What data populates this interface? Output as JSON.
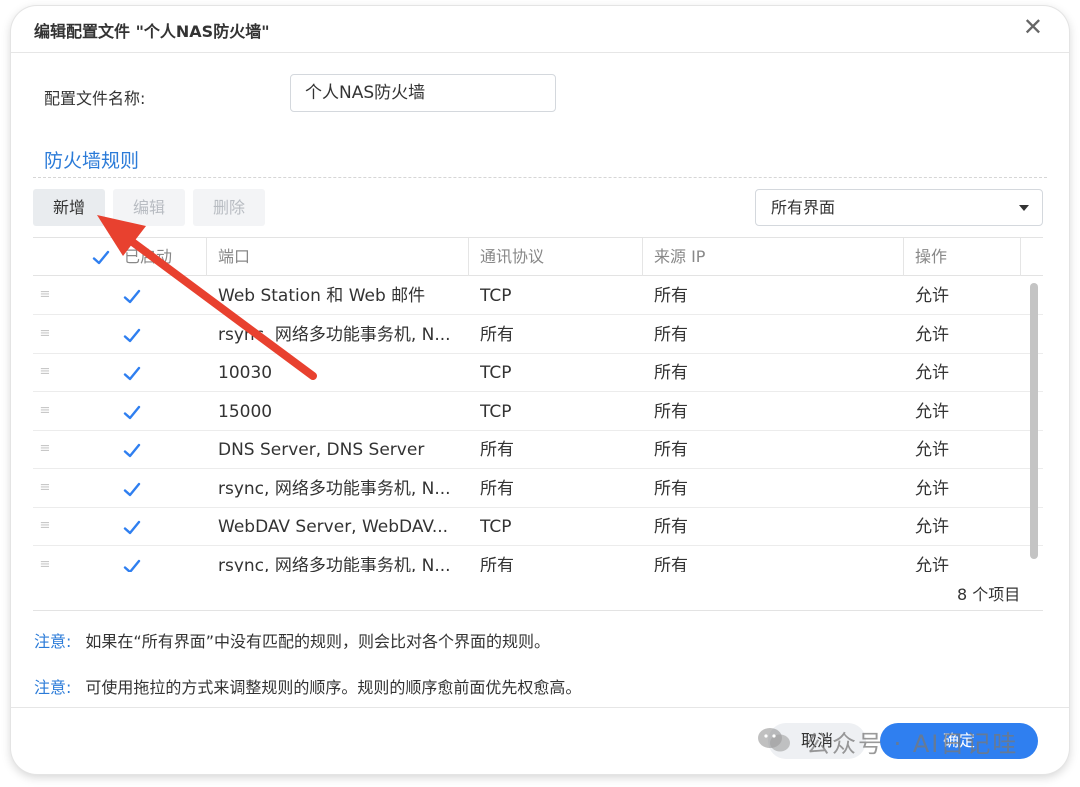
{
  "window": {
    "title": "编辑配置文件 \"个人NAS防火墙\""
  },
  "profile": {
    "label": "配置文件名称:",
    "value": "个人NAS防火墙"
  },
  "section": {
    "title": "防火墙规则"
  },
  "toolbar": {
    "add_label": "新增",
    "edit_label": "编辑",
    "delete_label": "删除"
  },
  "interface_select": {
    "value": "所有界面"
  },
  "table": {
    "headers": {
      "enabled": "已启动",
      "port": "端口",
      "protocol": "通讯协议",
      "source_ip": "来源 IP",
      "action": "操作"
    },
    "rows": [
      {
        "enabled": true,
        "port": "Web Station 和 Web 邮件",
        "protocol": "TCP",
        "source": "所有",
        "action": "允许"
      },
      {
        "enabled": true,
        "port": "rsync, 网络多功能事务机, N...",
        "protocol": "所有",
        "source": "所有",
        "action": "允许"
      },
      {
        "enabled": true,
        "port": "10030",
        "protocol": "TCP",
        "source": "所有",
        "action": "允许"
      },
      {
        "enabled": true,
        "port": "15000",
        "protocol": "TCP",
        "source": "所有",
        "action": "允许"
      },
      {
        "enabled": true,
        "port": "DNS Server, DNS Server",
        "protocol": "所有",
        "source": "所有",
        "action": "允许"
      },
      {
        "enabled": true,
        "port": "rsync, 网络多功能事务机, N...",
        "protocol": "所有",
        "source": "所有",
        "action": "允许"
      },
      {
        "enabled": true,
        "port": "WebDAV Server, WebDAV...",
        "protocol": "TCP",
        "source": "所有",
        "action": "允许"
      },
      {
        "enabled": true,
        "port": "rsync, 网络多功能事务机, N...",
        "protocol": "所有",
        "source": "所有",
        "action": "允许"
      }
    ],
    "item_count": "8 个项目"
  },
  "notes": [
    {
      "key": "注意:",
      "text": "如果在“所有界面”中没有匹配的规则，则会比对各个界面的规则。"
    },
    {
      "key": "注意:",
      "text": "可使用拖拉的方式来调整规则的顺序。规则的顺序愈前面优先权愈高。"
    }
  ],
  "footer": {
    "cancel_label": "取消",
    "ok_label": "确定"
  },
  "watermark": {
    "text": "公众号 · AI日记哇"
  },
  "colors": {
    "accent": "#2b7bd8",
    "primary_button": "#2f7ff0",
    "checkbox": "#2f7ff0",
    "annotation_arrow": "#e8412f"
  }
}
